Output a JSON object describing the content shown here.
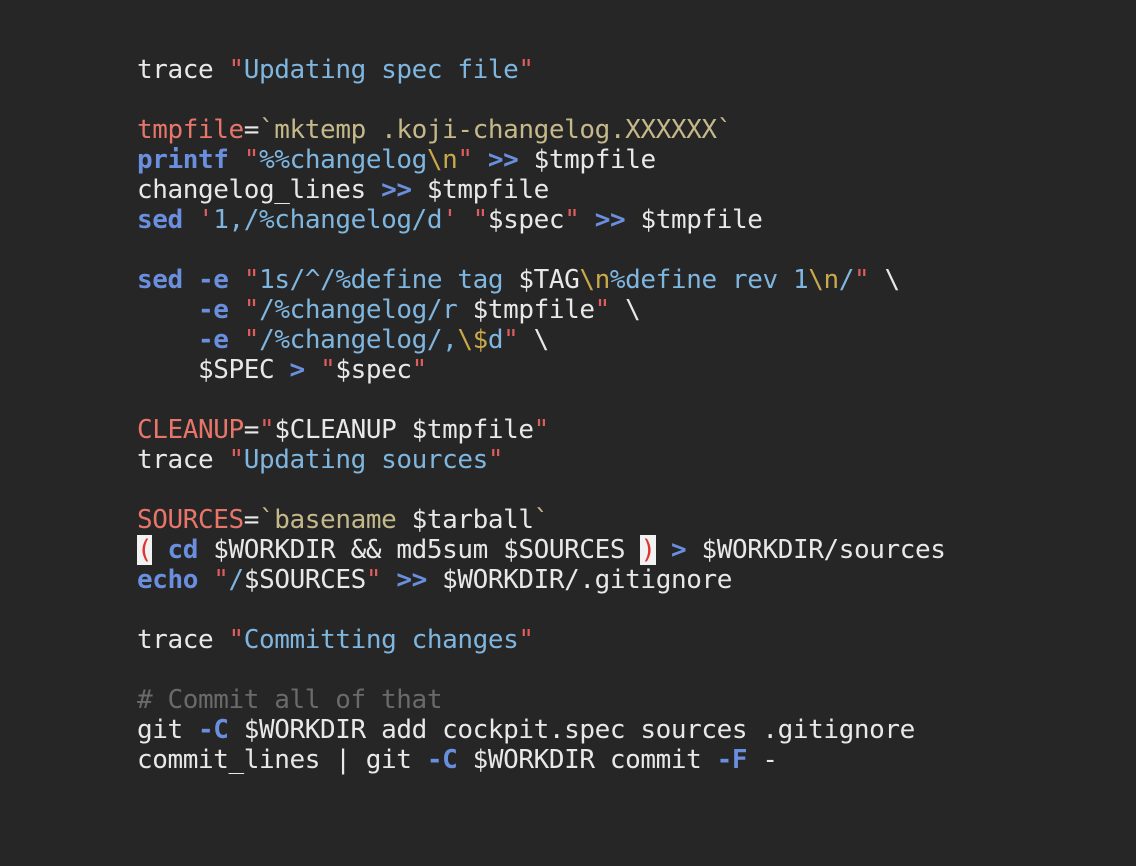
{
  "editor": {
    "lines": [
      [
        {
          "t": "trace ",
          "c": "plain"
        },
        {
          "t": "\"",
          "c": "quote"
        },
        {
          "t": "Updating spec file",
          "c": "string"
        },
        {
          "t": "\"",
          "c": "quote"
        }
      ],
      [],
      [
        {
          "t": "tmpfile",
          "c": "var"
        },
        {
          "t": "=",
          "c": "plain"
        },
        {
          "t": "`mktemp .koji-changelog.XXXXXX`",
          "c": "backtick"
        }
      ],
      [
        {
          "t": "printf",
          "c": "keyword"
        },
        {
          "t": " ",
          "c": "plain"
        },
        {
          "t": "\"",
          "c": "quote"
        },
        {
          "t": "%%changelog",
          "c": "string"
        },
        {
          "t": "\\n",
          "c": "escape"
        },
        {
          "t": "\"",
          "c": "quote"
        },
        {
          "t": " ",
          "c": "plain"
        },
        {
          "t": ">>",
          "c": "op"
        },
        {
          "t": " $tmpfile",
          "c": "plain"
        }
      ],
      [
        {
          "t": "changelog_lines ",
          "c": "plain"
        },
        {
          "t": ">>",
          "c": "op"
        },
        {
          "t": " $tmpfile",
          "c": "plain"
        }
      ],
      [
        {
          "t": "sed",
          "c": "keyword"
        },
        {
          "t": " ",
          "c": "plain"
        },
        {
          "t": "'",
          "c": "quote"
        },
        {
          "t": "1,/%changelog/d",
          "c": "string"
        },
        {
          "t": "'",
          "c": "quote"
        },
        {
          "t": " ",
          "c": "plain"
        },
        {
          "t": "\"",
          "c": "quote"
        },
        {
          "t": "$spec",
          "c": "plain"
        },
        {
          "t": "\"",
          "c": "quote"
        },
        {
          "t": " ",
          "c": "plain"
        },
        {
          "t": ">>",
          "c": "op"
        },
        {
          "t": " $tmpfile",
          "c": "plain"
        }
      ],
      [],
      [
        {
          "t": "sed",
          "c": "keyword"
        },
        {
          "t": " ",
          "c": "plain"
        },
        {
          "t": "-e",
          "c": "flag"
        },
        {
          "t": " ",
          "c": "plain"
        },
        {
          "t": "\"",
          "c": "quote"
        },
        {
          "t": "1s/^/%define tag ",
          "c": "string"
        },
        {
          "t": "$TAG",
          "c": "plain"
        },
        {
          "t": "\\n",
          "c": "escape"
        },
        {
          "t": "%define rev 1",
          "c": "string"
        },
        {
          "t": "\\n",
          "c": "escape"
        },
        {
          "t": "/",
          "c": "string"
        },
        {
          "t": "\"",
          "c": "quote"
        },
        {
          "t": " \\",
          "c": "plain"
        }
      ],
      [
        {
          "t": "    ",
          "c": "plain"
        },
        {
          "t": "-e",
          "c": "flag"
        },
        {
          "t": " ",
          "c": "plain"
        },
        {
          "t": "\"",
          "c": "quote"
        },
        {
          "t": "/%changelog/r ",
          "c": "string"
        },
        {
          "t": "$tmpfile",
          "c": "plain"
        },
        {
          "t": "\"",
          "c": "quote"
        },
        {
          "t": " \\",
          "c": "plain"
        }
      ],
      [
        {
          "t": "    ",
          "c": "plain"
        },
        {
          "t": "-e",
          "c": "flag"
        },
        {
          "t": " ",
          "c": "plain"
        },
        {
          "t": "\"",
          "c": "quote"
        },
        {
          "t": "/%changelog/,",
          "c": "string"
        },
        {
          "t": "\\$",
          "c": "escape"
        },
        {
          "t": "d",
          "c": "string"
        },
        {
          "t": "\"",
          "c": "quote"
        },
        {
          "t": " \\",
          "c": "plain"
        }
      ],
      [
        {
          "t": "    $SPEC ",
          "c": "plain"
        },
        {
          "t": ">",
          "c": "op"
        },
        {
          "t": " ",
          "c": "plain"
        },
        {
          "t": "\"",
          "c": "quote"
        },
        {
          "t": "$spec",
          "c": "plain"
        },
        {
          "t": "\"",
          "c": "quote"
        }
      ],
      [],
      [
        {
          "t": "CLEANUP",
          "c": "var"
        },
        {
          "t": "=",
          "c": "plain"
        },
        {
          "t": "\"",
          "c": "quote"
        },
        {
          "t": "$CLEANUP $tmpfile",
          "c": "plain"
        },
        {
          "t": "\"",
          "c": "quote"
        }
      ],
      [
        {
          "t": "trace ",
          "c": "plain"
        },
        {
          "t": "\"",
          "c": "quote"
        },
        {
          "t": "Updating sources",
          "c": "string"
        },
        {
          "t": "\"",
          "c": "quote"
        }
      ],
      [],
      [
        {
          "t": "SOURCES",
          "c": "var"
        },
        {
          "t": "=",
          "c": "plain"
        },
        {
          "t": "`basename ",
          "c": "backtick"
        },
        {
          "t": "$tarball",
          "c": "plain"
        },
        {
          "t": "`",
          "c": "backtick"
        }
      ],
      [
        {
          "t": "(",
          "c": "bracket-match"
        },
        {
          "t": " ",
          "c": "plain"
        },
        {
          "t": "cd",
          "c": "keyword"
        },
        {
          "t": " $WORKDIR && md5sum $SOURCES ",
          "c": "plain"
        },
        {
          "t": ")",
          "c": "bracket-match"
        },
        {
          "t": " ",
          "c": "plain"
        },
        {
          "t": ">",
          "c": "op"
        },
        {
          "t": " $WORKDIR/sources",
          "c": "plain"
        }
      ],
      [
        {
          "t": "echo",
          "c": "keyword"
        },
        {
          "t": " ",
          "c": "plain"
        },
        {
          "t": "\"",
          "c": "quote"
        },
        {
          "t": "/",
          "c": "string"
        },
        {
          "t": "$SOURCES",
          "c": "plain"
        },
        {
          "t": "\"",
          "c": "quote"
        },
        {
          "t": " ",
          "c": "plain"
        },
        {
          "t": ">>",
          "c": "op"
        },
        {
          "t": " $WORKDIR/.gitignore",
          "c": "plain"
        }
      ],
      [],
      [
        {
          "t": "trace ",
          "c": "plain"
        },
        {
          "t": "\"",
          "c": "quote"
        },
        {
          "t": "Committing changes",
          "c": "string"
        },
        {
          "t": "\"",
          "c": "quote"
        }
      ],
      [],
      [
        {
          "t": "# Commit all of that",
          "c": "comment"
        }
      ],
      [
        {
          "t": "git ",
          "c": "plain"
        },
        {
          "t": "-C",
          "c": "flag"
        },
        {
          "t": " $WORKDIR add cockpit.spec sources .gitignore",
          "c": "plain"
        }
      ],
      [
        {
          "t": "commit_lines | git ",
          "c": "plain"
        },
        {
          "t": "-C",
          "c": "flag"
        },
        {
          "t": " $WORKDIR commit ",
          "c": "plain"
        },
        {
          "t": "-F",
          "c": "flag"
        },
        {
          "t": " -",
          "c": "plain"
        }
      ]
    ]
  }
}
